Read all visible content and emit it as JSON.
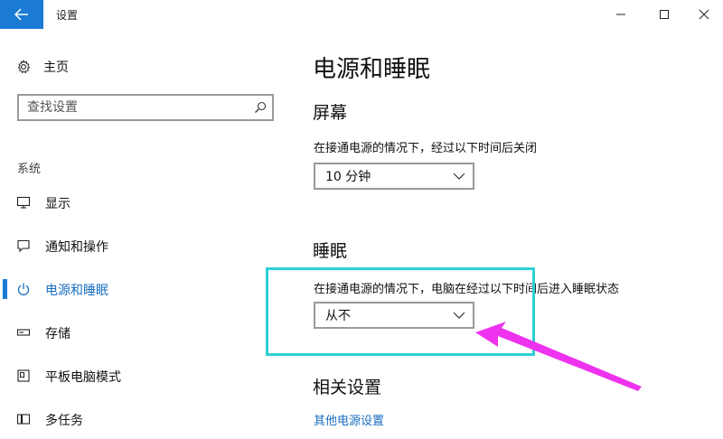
{
  "window": {
    "title": "设置"
  },
  "sidebar": {
    "home_label": "主页",
    "search_placeholder": "查找设置",
    "section_label": "系统",
    "items": [
      {
        "label": "显示",
        "icon": "monitor-icon"
      },
      {
        "label": "通知和操作",
        "icon": "notification-icon"
      },
      {
        "label": "电源和睡眠",
        "icon": "power-icon",
        "active": true
      },
      {
        "label": "存储",
        "icon": "storage-icon"
      },
      {
        "label": "平板电脑模式",
        "icon": "tablet-mode-icon"
      },
      {
        "label": "多任务",
        "icon": "multitask-icon"
      }
    ]
  },
  "main": {
    "title": "电源和睡眠",
    "screen": {
      "heading": "屏幕",
      "desc": "在接通电源的情况下，经过以下时间后关闭",
      "value": "10 分钟"
    },
    "sleep": {
      "heading": "睡眠",
      "desc": "在接通电源的情况下，电脑在经过以下时间后进入睡眠状态",
      "value": "从不"
    },
    "related": {
      "heading": "相关设置",
      "link": "其他电源设置"
    }
  },
  "colors": {
    "accent": "#1a7ad4",
    "link": "#1a6ec0",
    "highlight_box": "#2fd0d5",
    "annotation_arrow": "#ee33ee"
  }
}
